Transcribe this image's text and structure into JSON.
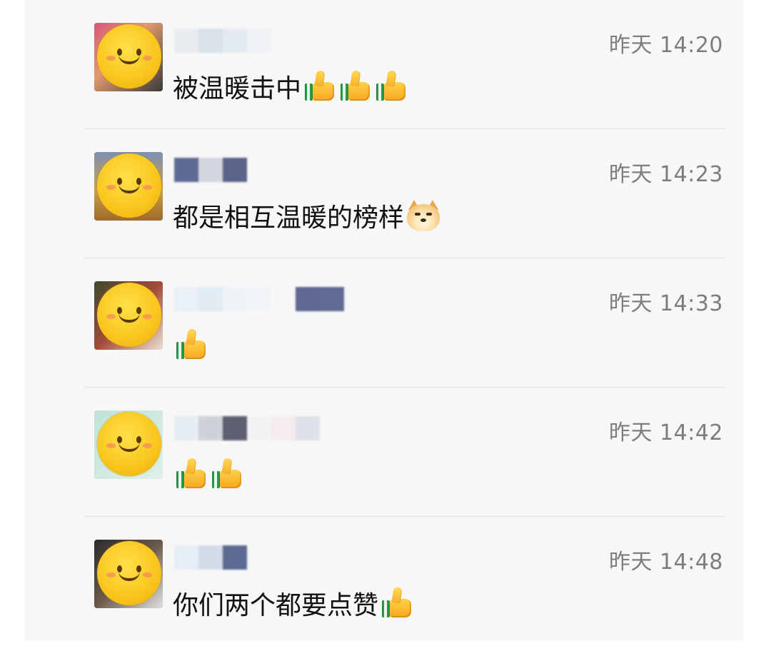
{
  "comments": [
    {
      "time": "昨天 14:20",
      "text": "被温暖击中",
      "emojis": [
        "thumbs-up",
        "thumbs-up",
        "thumbs-up"
      ],
      "avatar_bg": "bg-a",
      "name_blur_colors": [
        "#e8ecef",
        "#d9e2ea",
        "#e3eaf0",
        "#eef2f4"
      ]
    },
    {
      "time": "昨天 14:23",
      "text": "都是相互温暖的榜样",
      "emojis": [
        "doge"
      ],
      "avatar_bg": "bg-b",
      "name_blur_colors": [
        "#5e6a92",
        "#d3d6df",
        "#5a6488"
      ]
    },
    {
      "time": "昨天 14:33",
      "text": "",
      "emojis": [
        "thumbs-up"
      ],
      "avatar_bg": "bg-c",
      "name_blur_colors": [
        "#e9f0f6",
        "#e0ebf3",
        "#eef3f7",
        "#f2f5f8",
        "#f7f7f8",
        "#5e6892",
        "#606a92"
      ]
    },
    {
      "time": "昨天 14:42",
      "text": "",
      "emojis": [
        "thumbs-up",
        "thumbs-up"
      ],
      "avatar_bg": "bg-d",
      "name_blur_colors": [
        "#e6ecf4",
        "#cdd1da",
        "#5c6070",
        "#f2f2f2",
        "#f4ecef",
        "#dde2ea"
      ]
    },
    {
      "time": "昨天 14:48",
      "text": "你们两个都要点赞",
      "emojis": [
        "thumbs-up"
      ],
      "avatar_bg": "bg-e",
      "name_blur_colors": [
        "#e6edf6",
        "#d3dbe8",
        "#5e6a92"
      ]
    }
  ]
}
